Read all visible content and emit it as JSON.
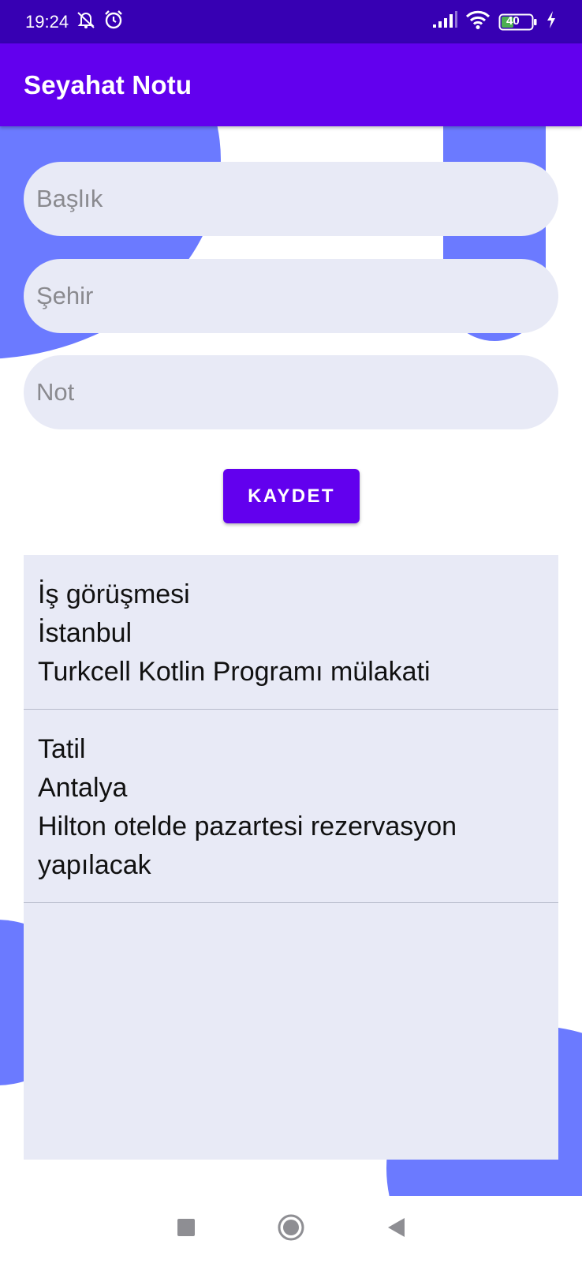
{
  "status_bar": {
    "time": "19:24",
    "battery": "40",
    "icons": [
      "mute-notifications-icon",
      "alarm-icon",
      "signal-icon",
      "wifi-icon",
      "battery-icon",
      "charging-icon"
    ]
  },
  "app_bar": {
    "title": "Seyahat Notu"
  },
  "form": {
    "title_placeholder": "Başlık",
    "city_placeholder": "Şehir",
    "note_placeholder": "Not",
    "save_label": "KAYDET"
  },
  "notes": [
    {
      "title": "İş görüşmesi",
      "city": "İstanbul",
      "note": "Turkcell Kotlin Programı mülakati"
    },
    {
      "title": "Tatil",
      "city": "Antalya",
      "note": "Hilton otelde pazartesi rezervasyon yapılacak"
    }
  ],
  "nav_bar": {
    "icons": [
      "recents-icon",
      "home-icon",
      "back-icon"
    ]
  },
  "colors": {
    "status_bar": "#3700b3",
    "app_bar": "#6200ee",
    "accent_blob": "#6b7aff",
    "field_bg": "#e8eaf6"
  }
}
